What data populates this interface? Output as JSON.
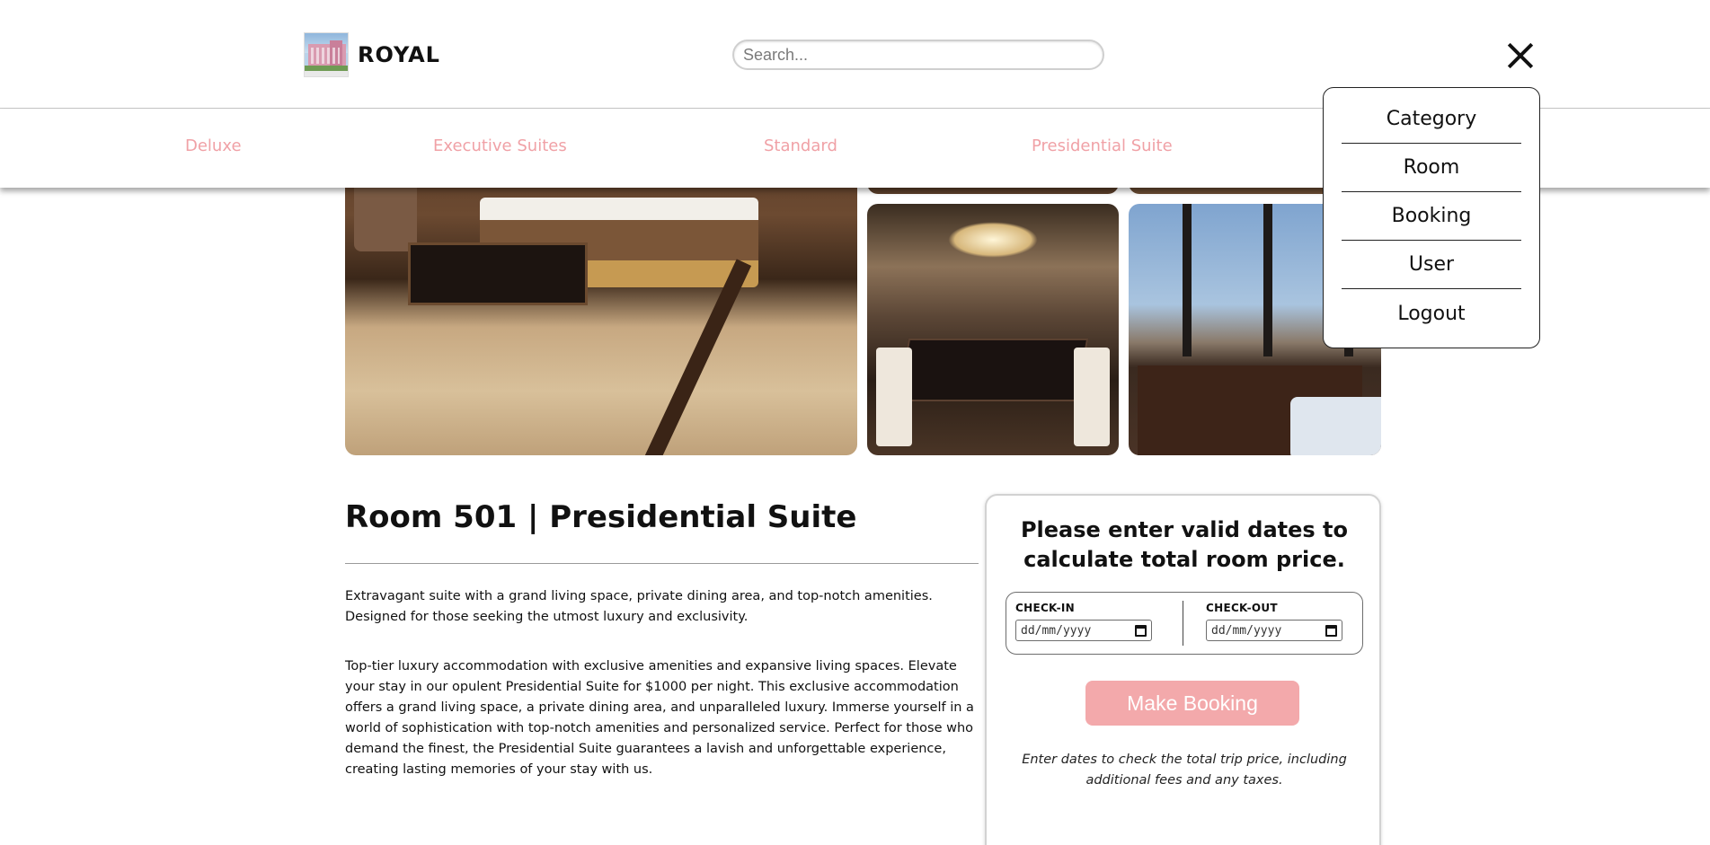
{
  "header": {
    "brand": "ROYAL",
    "search_placeholder": "Search..."
  },
  "categories": [
    {
      "label": "Deluxe"
    },
    {
      "label": "Executive Suites"
    },
    {
      "label": "Standard"
    },
    {
      "label": "Presidential Suite"
    }
  ],
  "menu": {
    "items": [
      {
        "label": "Category"
      },
      {
        "label": "Room"
      },
      {
        "label": "Booking"
      },
      {
        "label": "User"
      },
      {
        "label": "Logout"
      }
    ]
  },
  "room": {
    "title": "Room 501 | Presidential Suite",
    "short_description": "Extravagant suite with a grand living space, private dining area, and top-notch amenities. Designed for those seeking the utmost luxury and exclusivity.",
    "long_description": "Top-tier luxury accommodation with exclusive amenities and expansive living spaces. Elevate your stay in our opulent Presidential Suite for $1000 per night. This exclusive accommodation offers a grand living space, a private dining area, and unparalleled luxury. Immerse yourself in a world of sophistication with top-notch amenities and personalized service. Perfect for those who demand the finest, the Presidential Suite guarantees a lavish and unforgettable experience, creating lasting memories of your stay with us."
  },
  "booking": {
    "heading": "Please enter valid dates to calculate total room price.",
    "checkin_label": "CHECK-IN",
    "checkout_label": "CHECK-OUT",
    "date_placeholder": "dd/mm/yyyy",
    "button_label": "Make Booking",
    "note": "Enter dates to check the total trip price, including additional fees and any taxes."
  },
  "colors": {
    "accent_pink": "#f3a9ab",
    "category_text": "#f0a1a6"
  }
}
